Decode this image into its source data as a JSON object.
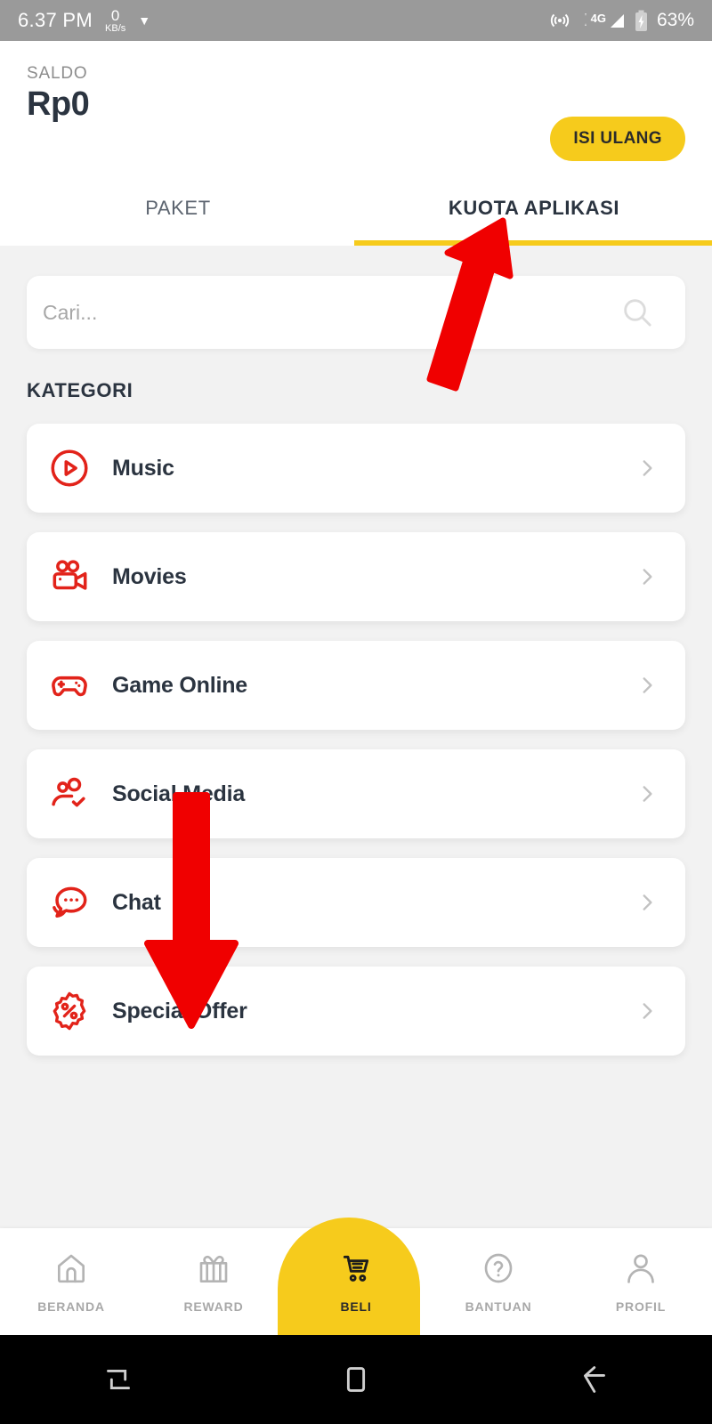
{
  "status_bar": {
    "time": "6.37 PM",
    "net_speed_value": "0",
    "net_speed_unit": "KB/s",
    "caret_icon": "chevron-down-icon",
    "hotspot_icon": "hotspot-icon",
    "network_type": "4G",
    "signal_icon": "signal-bars-icon",
    "battery_icon": "battery-charging-icon",
    "battery_percent": "63%",
    "background": "#9a9a9a"
  },
  "header": {
    "saldo_label": "SALDO",
    "saldo_value": "Rp0",
    "topup_button": "ISI ULANG",
    "topup_color": "#F6CB1C"
  },
  "tabs": {
    "items": [
      {
        "label": "PAKET",
        "active": false
      },
      {
        "label": "KUOTA APLIKASI",
        "active": true
      }
    ],
    "indicator_color": "#F6CB1C"
  },
  "search": {
    "placeholder": "Cari...",
    "value": "",
    "icon": "search-icon"
  },
  "section": {
    "title": "KATEGORI"
  },
  "categories": {
    "accent_color": "#E2231A",
    "items": [
      {
        "label": "Music",
        "icon": "play-circle-icon"
      },
      {
        "label": "Movies",
        "icon": "video-camera-icon"
      },
      {
        "label": "Game Online",
        "icon": "gamepad-icon"
      },
      {
        "label": "Social Media",
        "icon": "users-check-icon"
      },
      {
        "label": "Chat",
        "icon": "chat-bubbles-icon"
      },
      {
        "label": "Special Offer",
        "icon": "percent-badge-icon"
      }
    ],
    "chevron_icon": "chevron-right-icon"
  },
  "bottom_nav": {
    "active_color": "#F6CB1C",
    "items": [
      {
        "label": "BERANDA",
        "icon": "home-icon",
        "active": false
      },
      {
        "label": "REWARD",
        "icon": "gift-icon",
        "active": false
      },
      {
        "label": "BELI",
        "icon": "cart-icon",
        "active": true
      },
      {
        "label": "BANTUAN",
        "icon": "help-icon",
        "active": false
      },
      {
        "label": "PROFIL",
        "icon": "person-icon",
        "active": false
      }
    ]
  },
  "android_nav": {
    "buttons": [
      {
        "icon": "recents-icon"
      },
      {
        "icon": "home-square-icon"
      },
      {
        "icon": "back-arrow-icon"
      }
    ]
  },
  "annotations": {
    "color": "#F00000",
    "arrows": [
      {
        "name": "arrow-pointing-to-kuota-aplikasi-tab",
        "direction": "up"
      },
      {
        "name": "arrow-pointing-to-special-offer",
        "direction": "down"
      }
    ]
  }
}
